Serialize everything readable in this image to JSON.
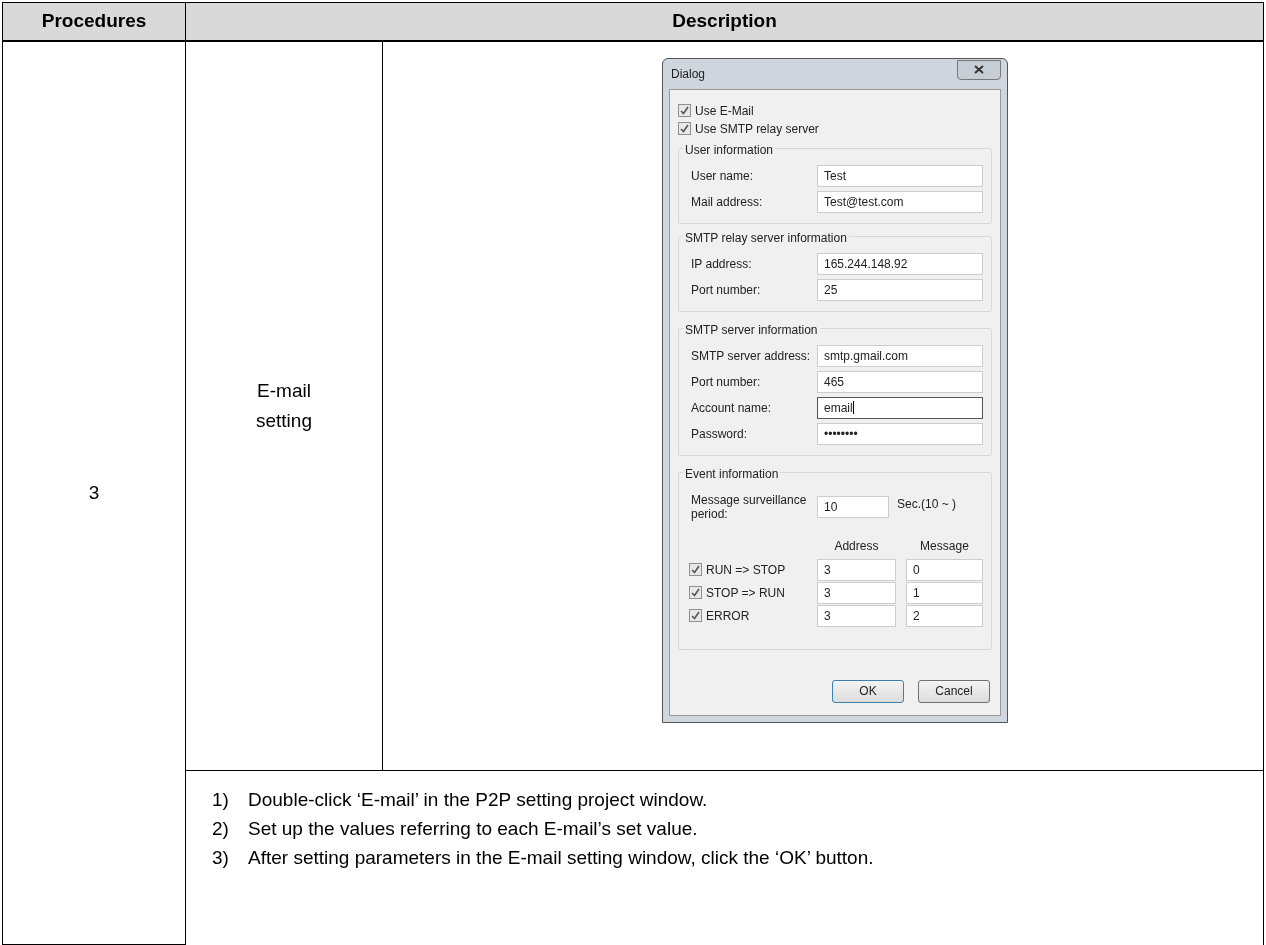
{
  "table": {
    "headers": [
      "Procedures",
      "Description"
    ],
    "step": "3",
    "procedure": "E-mail setting",
    "dialog": {
      "title": "Dialog",
      "checkboxes": [
        {
          "label": "Use E-Mail",
          "checked": true
        },
        {
          "label": "Use SMTP relay server",
          "checked": true
        }
      ],
      "groups": [
        {
          "title": "User information",
          "fields": [
            {
              "label": "User name:",
              "value": "Test",
              "focused": false
            },
            {
              "label": "Mail address:",
              "value": "Test@test.com",
              "focused": false
            }
          ]
        },
        {
          "title": "SMTP relay server information",
          "fields": [
            {
              "label": "IP address:",
              "value": "165.244.148.92",
              "focused": false
            },
            {
              "label": "Port number:",
              "value": "25",
              "focused": false
            }
          ]
        },
        {
          "title": "SMTP server information",
          "fields": [
            {
              "label": "SMTP server address:",
              "value": "smtp.gmail.com",
              "focused": false
            },
            {
              "label": "Port number:",
              "value": "465",
              "focused": false
            },
            {
              "label": "Account name:",
              "value": "email",
              "focused": true
            },
            {
              "label": "Password:",
              "value": "••••••••",
              "focused": false
            }
          ]
        }
      ],
      "event_group": {
        "title": "Event information",
        "period_label": "Message surveillance period:",
        "period_value": "10",
        "period_unit": "Sec.(10 ~ )",
        "columns": [
          "Address",
          "Message"
        ],
        "events": [
          {
            "label": "RUN => STOP",
            "checked": true,
            "address": "3",
            "message": "0"
          },
          {
            "label": "STOP => RUN",
            "checked": true,
            "address": "3",
            "message": "1"
          },
          {
            "label": "ERROR",
            "checked": true,
            "address": "3",
            "message": "2"
          }
        ]
      },
      "buttons": [
        {
          "label": "OK",
          "default": true
        },
        {
          "label": "Cancel",
          "default": false
        }
      ]
    },
    "instructions": [
      {
        "number": "1)",
        "text": "Double-click ‘E-mail’ in the P2P setting project window."
      },
      {
        "number": "2)",
        "text": "Set up the values referring to each E-mail’s set value."
      },
      {
        "number": "3)",
        "text": "After setting parameters in the E-mail setting window, click the ‘OK’ button."
      }
    ]
  }
}
